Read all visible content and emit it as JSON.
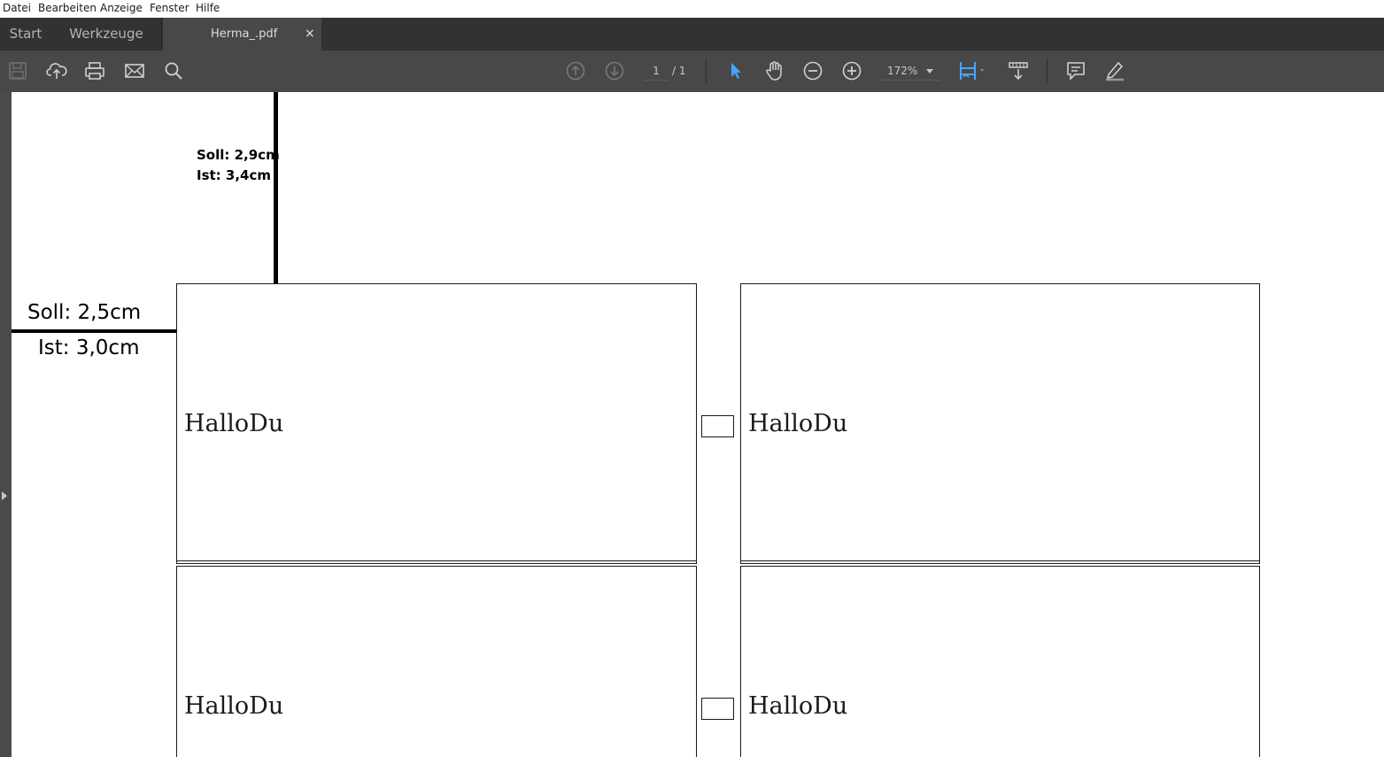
{
  "menu": {
    "items": [
      "Datei",
      "Bearbeiten",
      "Anzeige",
      "Fenster",
      "Hilfe"
    ]
  },
  "tabs": {
    "start": "Start",
    "tools": "Werkzeuge",
    "document": "Herma_.pdf",
    "close_glyph": "×"
  },
  "toolbar": {
    "icons": [
      "save-icon",
      "cloud-upload-icon",
      "print-icon",
      "email-icon",
      "search-icon",
      "page-up-icon",
      "page-down-icon",
      "select-arrow-icon",
      "hand-tool-icon",
      "zoom-out-icon",
      "zoom-in-icon",
      "fit-page-icon",
      "scroll-mode-icon",
      "comment-icon",
      "highlight-pen-icon"
    ],
    "page_current": "1",
    "page_total": "/ 1",
    "zoom": "172%",
    "accent_color": "#4aa3ff"
  },
  "document": {
    "top_annotation": {
      "soll": "Soll: 2,9cm",
      "ist": "Ist: 3,4cm"
    },
    "left_annotation": {
      "soll": "Soll: 2,5cm",
      "ist": "Ist: 3,0cm"
    },
    "labels": [
      "HalloDu",
      "HalloDu",
      "HalloDu",
      "HalloDu"
    ]
  }
}
